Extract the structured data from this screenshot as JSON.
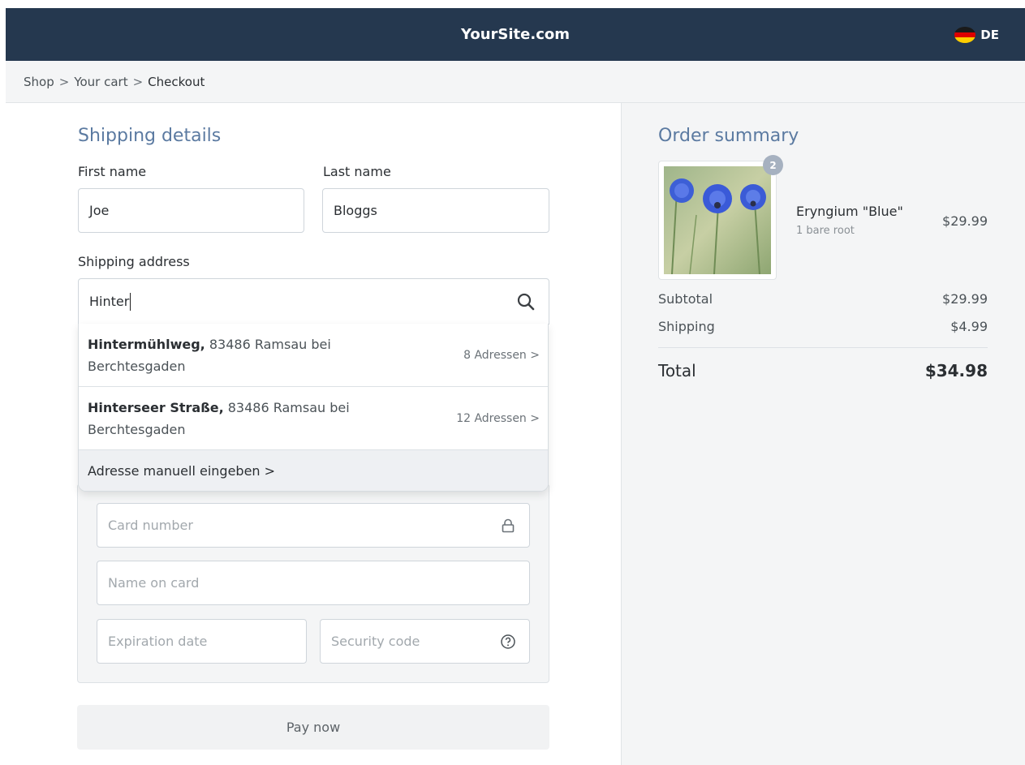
{
  "header": {
    "site_title": "YourSite.com",
    "language_code": "DE",
    "flag_icon": "german-flag-icon"
  },
  "breadcrumb": {
    "items": [
      "Shop",
      "Your cart",
      "Checkout"
    ],
    "separator": ">"
  },
  "shipping": {
    "heading": "Shipping details",
    "first_name_label": "First name",
    "first_name_value": "Joe",
    "last_name_label": "Last name",
    "last_name_value": "Bloggs",
    "address_label": "Shipping address",
    "address_value": "Hinter",
    "address_icon": "search-icon",
    "suggestions": [
      {
        "street": "Hintermühlweg,",
        "place": "83486 Ramsau bei Berchtesgaden",
        "count": "8 Adressen >"
      },
      {
        "street": "Hinterseer Straße,",
        "place": "83486 Ramsau bei Berchtesgaden",
        "count": "12 Adressen >"
      }
    ],
    "manual_entry": "Adresse manuell eingeben >"
  },
  "payment": {
    "card_number_placeholder": "Card number",
    "card_number_icon": "lock-icon",
    "name_on_card_placeholder": "Name on card",
    "expiration_placeholder": "Expiration date",
    "security_code_placeholder": "Security code",
    "security_code_icon": "help-circle-icon",
    "pay_button": "Pay now"
  },
  "summary": {
    "heading": "Order summary",
    "item": {
      "quantity": "2",
      "name": "Eryngium \"Blue\"",
      "variant": "1 bare root",
      "price": "$29.99"
    },
    "subtotal_label": "Subtotal",
    "subtotal_value": "$29.99",
    "shipping_label": "Shipping",
    "shipping_value": "$4.99",
    "total_label": "Total",
    "total_value": "$34.98"
  },
  "colors": {
    "header_bg": "#25384f",
    "heading_blue": "#5b7aa1",
    "panel_gray": "#f4f5f6"
  }
}
